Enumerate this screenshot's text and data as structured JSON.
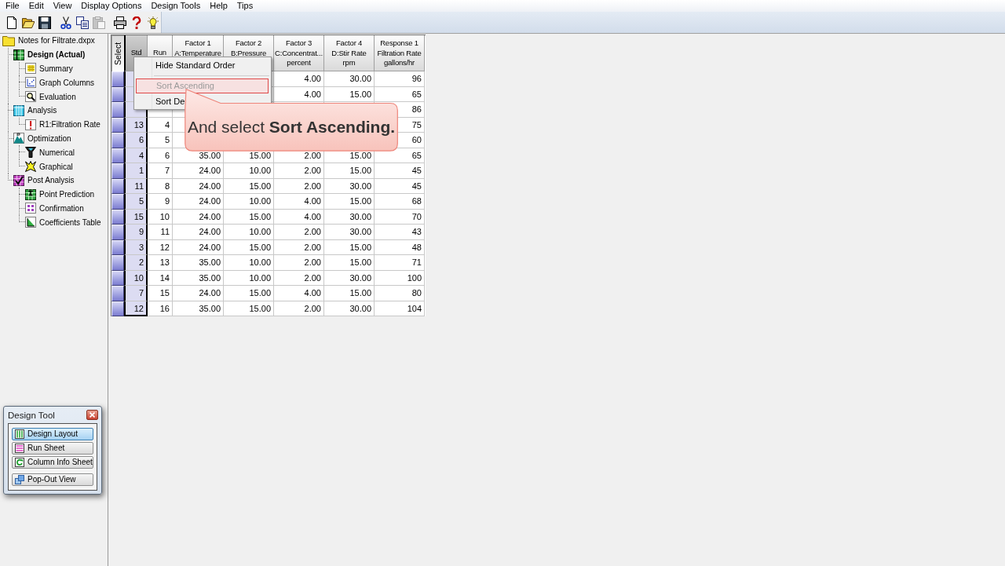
{
  "menu_bar": [
    "File",
    "Edit",
    "View",
    "Display Options",
    "Design Tools",
    "Help",
    "Tips"
  ],
  "toolbar": [
    {
      "disabled": false
    },
    {
      "disabled": false
    },
    {
      "disabled": false
    },
    {
      "disabled": false
    },
    {
      "disabled": false
    },
    {
      "disabled": true
    },
    {
      "disabled": false
    },
    {
      "disabled": false
    },
    {
      "disabled": false
    }
  ],
  "tree": {
    "label": "Notes for Filtrate.dxpx",
    "selected": false,
    "children": [
      {
        "label": "Design (Actual)",
        "selected": true,
        "children": [
          {
            "label": "Summary",
            "selected": false
          },
          {
            "label": "Graph Columns",
            "selected": false
          },
          {
            "label": "Evaluation",
            "selected": false
          }
        ]
      },
      {
        "label": "Analysis",
        "selected": false,
        "children": [
          {
            "label": "R1:Filtration Rate",
            "selected": false
          }
        ]
      },
      {
        "label": "Optimization",
        "selected": false,
        "children": [
          {
            "label": "Numerical",
            "selected": false
          },
          {
            "label": "Graphical",
            "selected": false
          }
        ]
      },
      {
        "label": "Post Analysis",
        "selected": false,
        "children": [
          {
            "label": "Point Prediction",
            "selected": false
          },
          {
            "label": "Confirmation",
            "selected": false
          },
          {
            "label": "Coefficients Table",
            "selected": false
          }
        ]
      }
    ]
  },
  "table": {
    "select_header": "Select",
    "columns": [
      {
        "lines": [
          "Std"
        ],
        "selected": true
      },
      {
        "lines": [
          "Run"
        ],
        "selected": false
      },
      {
        "lines": [
          "Factor 1",
          "A:Temperature"
        ],
        "selected": false
      },
      {
        "lines": [
          "Factor 2",
          "B:Pressure"
        ],
        "selected": false
      },
      {
        "lines": [
          "Factor 3",
          "C:Concentrat...",
          "percent"
        ],
        "selected": false
      },
      {
        "lines": [
          "Factor 4",
          "D:Stir Rate",
          "rpm"
        ],
        "selected": false
      },
      {
        "lines": [
          "Response 1",
          "Filtration Rate",
          "gallons/hr"
        ],
        "selected": false
      }
    ],
    "rows": [
      [
        null,
        null,
        null,
        null,
        "4.00",
        "30.00",
        "96"
      ],
      [
        null,
        null,
        null,
        null,
        "4.00",
        "15.00",
        "65"
      ],
      [
        null,
        null,
        null,
        null,
        null,
        null,
        "86"
      ],
      [
        "13",
        "4",
        null,
        null,
        null,
        null,
        "75"
      ],
      [
        "6",
        "5",
        null,
        null,
        null,
        null,
        "60"
      ],
      [
        "4",
        "6",
        "35.00",
        "15.00",
        "2.00",
        "15.00",
        "65"
      ],
      [
        "1",
        "7",
        "24.00",
        "10.00",
        "2.00",
        "15.00",
        "45"
      ],
      [
        "11",
        "8",
        "24.00",
        "15.00",
        "2.00",
        "30.00",
        "45"
      ],
      [
        "5",
        "9",
        "24.00",
        "10.00",
        "4.00",
        "15.00",
        "68"
      ],
      [
        "15",
        "10",
        "24.00",
        "15.00",
        "4.00",
        "30.00",
        "70"
      ],
      [
        "9",
        "11",
        "24.00",
        "10.00",
        "2.00",
        "30.00",
        "43"
      ],
      [
        "3",
        "12",
        "24.00",
        "15.00",
        "2.00",
        "15.00",
        "48"
      ],
      [
        "2",
        "13",
        "35.00",
        "10.00",
        "2.00",
        "15.00",
        "71"
      ],
      [
        "10",
        "14",
        "35.00",
        "10.00",
        "2.00",
        "30.00",
        "100"
      ],
      [
        "7",
        "15",
        "24.00",
        "15.00",
        "4.00",
        "15.00",
        "80"
      ],
      [
        "12",
        "16",
        "35.00",
        "15.00",
        "2.00",
        "30.00",
        "104"
      ]
    ]
  },
  "context_menu": {
    "items": [
      {
        "kind": "item",
        "label": "Hide Standard Order",
        "selected": false
      },
      {
        "kind": "separator"
      },
      {
        "kind": "item",
        "label": "Sort Ascending",
        "selected": true
      },
      {
        "kind": "item",
        "label": "Sort De",
        "selected": false
      }
    ]
  },
  "callout": {
    "text": "And select **Sort Ascending.**"
  },
  "design_tool": {
    "title": "Design Tool",
    "buttons": [
      {
        "label": "Design Layout",
        "selected": true
      },
      {
        "label": "Run Sheet",
        "selected": false
      },
      {
        "label": "Column Info Sheet",
        "selected": false
      },
      {
        "label": "Pop-Out View",
        "selected": false
      }
    ]
  }
}
